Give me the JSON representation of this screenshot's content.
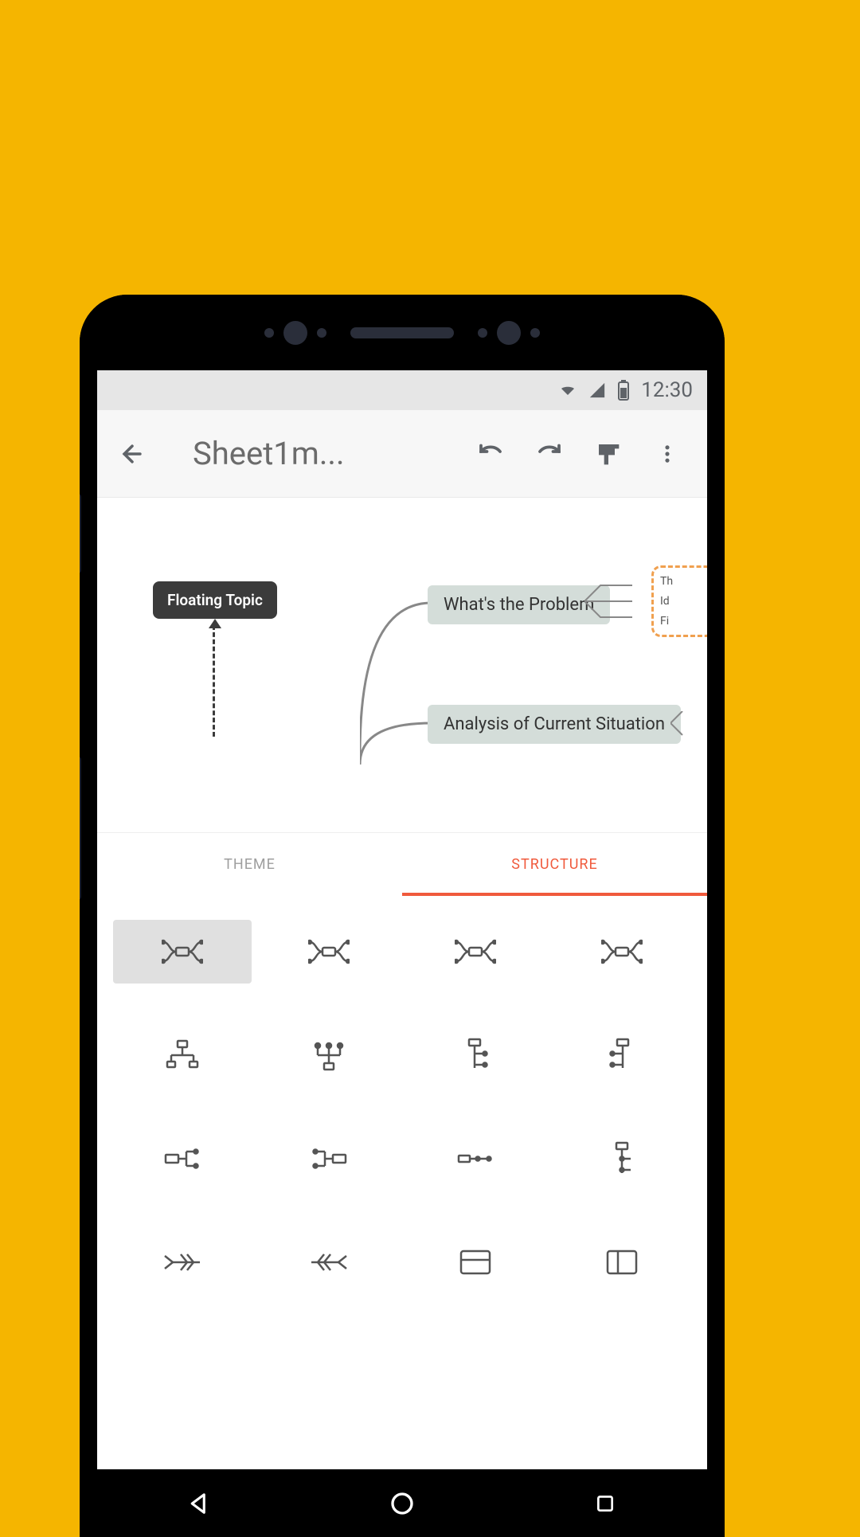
{
  "status": {
    "time": "12:30"
  },
  "appbar": {
    "title": "Sheet1m..."
  },
  "canvas": {
    "floating": "Floating Topic",
    "node_a": "What's the Problem",
    "node_b": "Analysis of Current Situation",
    "sub1": "Th",
    "sub2": "Id",
    "sub3": "Fi"
  },
  "tabs": {
    "theme": "THEME",
    "structure": "STRUCTURE"
  },
  "structures": [
    "mindmap-balanced",
    "mindmap-clockwise",
    "mindmap-right",
    "mindmap-left",
    "orgchart-down",
    "orgchart-up",
    "tree-right",
    "tree-left",
    "logic-right",
    "logic-left",
    "timeline-right",
    "timeline-down",
    "fishbone-left",
    "fishbone-right",
    "spreadsheet",
    "matrix-columns"
  ]
}
